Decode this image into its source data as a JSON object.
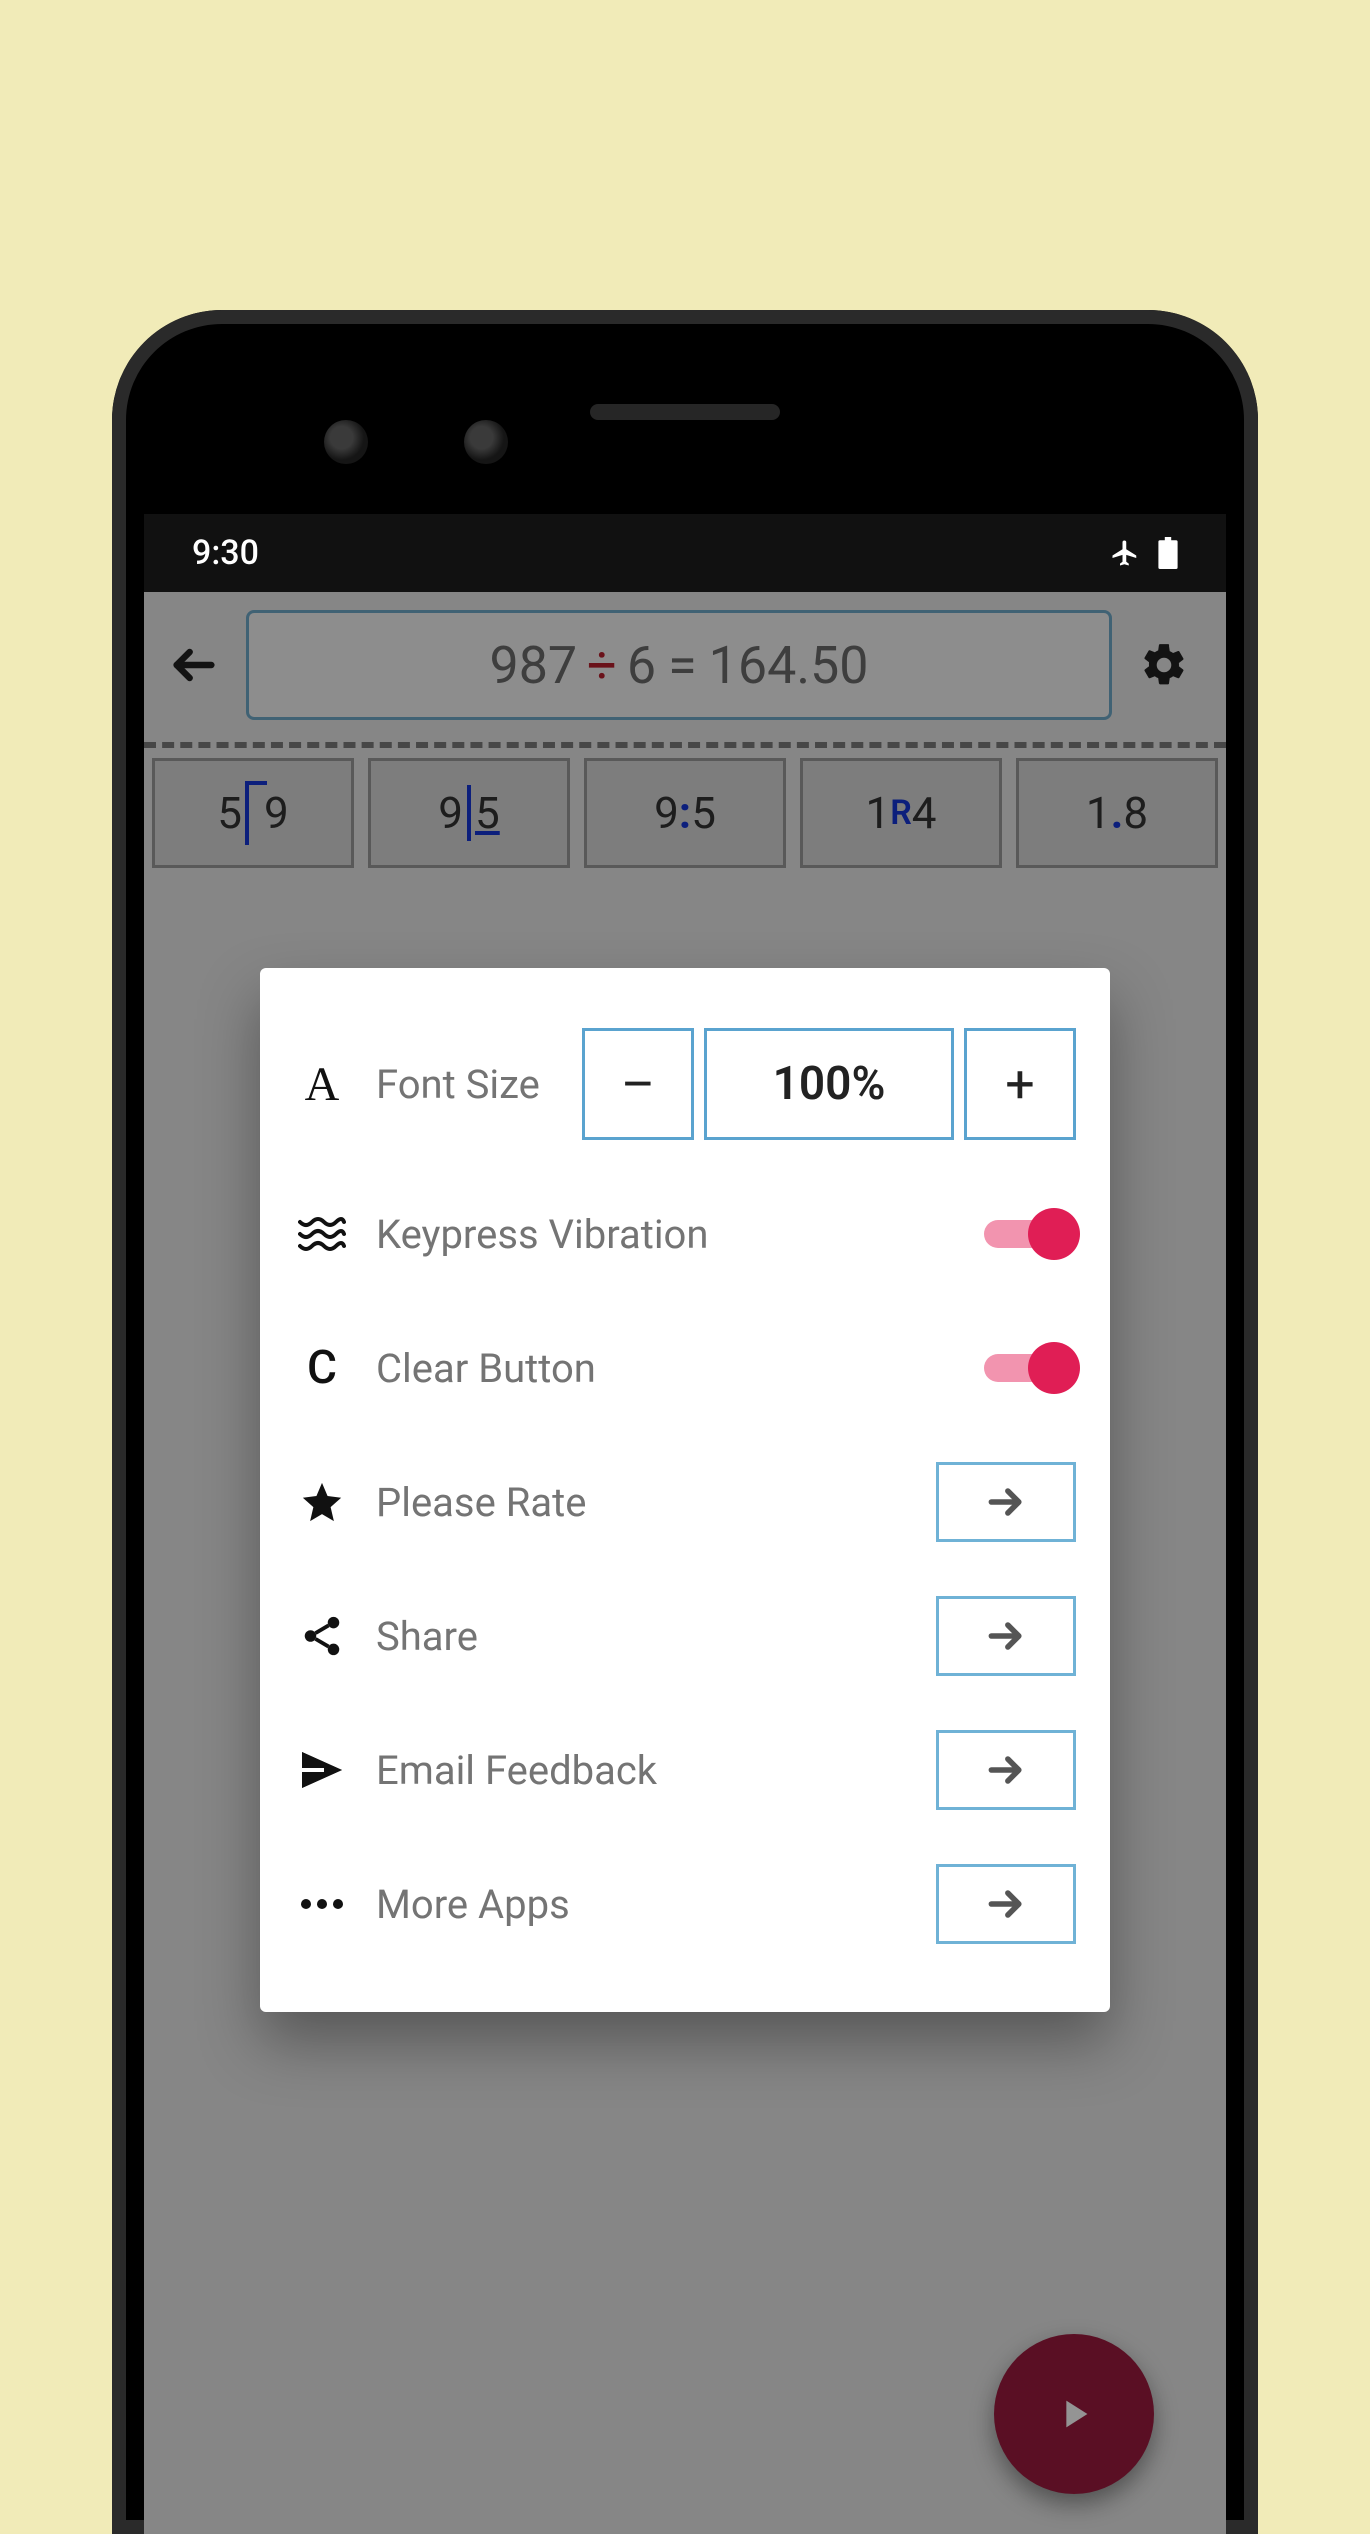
{
  "statusbar": {
    "time": "9:30"
  },
  "header": {
    "expression": {
      "left": "987",
      "op": "÷",
      "right": "6",
      "eq": "=",
      "result": "164.50"
    }
  },
  "methods": [
    {
      "a": "5",
      "b": "9"
    },
    {
      "a": "9",
      "b": "5"
    },
    {
      "a": "9",
      "sep": ":",
      "b": "5"
    },
    {
      "a": "1",
      "mid": "R",
      "b": "4"
    },
    {
      "a": "1",
      "sep": ".",
      "b": "8"
    }
  ],
  "settings": {
    "font_size": {
      "label": "Font Size",
      "value": "100%",
      "minus": "–",
      "plus": "+"
    },
    "keypress_vibration": {
      "label": "Keypress Vibration",
      "on": true
    },
    "clear_button": {
      "label": "Clear Button",
      "icon_text": "C",
      "on": true
    },
    "please_rate": {
      "label": "Please Rate"
    },
    "share": {
      "label": "Share"
    },
    "email_feedback": {
      "label": "Email Feedback"
    },
    "more_apps": {
      "label": "More Apps"
    }
  }
}
